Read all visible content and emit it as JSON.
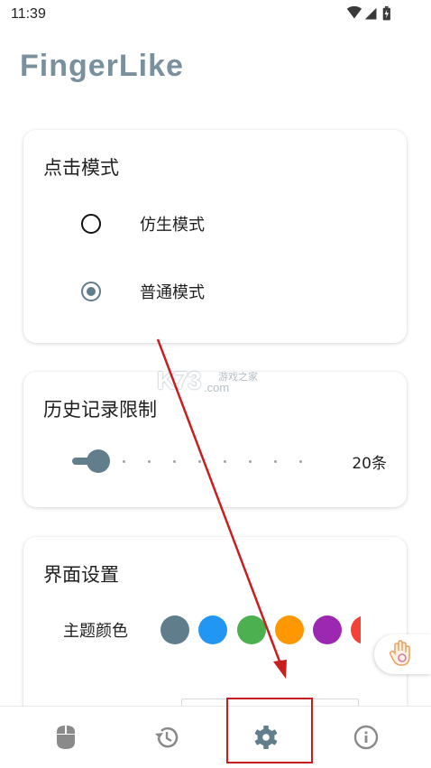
{
  "status": {
    "time": "11:39"
  },
  "app": {
    "title": "FingerLike"
  },
  "click_mode": {
    "title": "点击模式",
    "options": [
      {
        "label": "仿生模式",
        "selected": false
      },
      {
        "label": "普通模式",
        "selected": true
      }
    ]
  },
  "history": {
    "title": "历史记录限制",
    "value_label": "20条",
    "slider_fraction": 0.0
  },
  "ui_settings": {
    "title": "界面设置",
    "theme_label": "主题颜色",
    "colors": [
      "#607d8b",
      "#2196f3",
      "#4caf50",
      "#ff9800",
      "#9c27b0",
      "#f44336"
    ]
  },
  "watermark": {
    "big": "K73",
    "small1": "游戏之家",
    "small2": ".com"
  },
  "nav": {
    "items": [
      {
        "icon": "mouse-icon"
      },
      {
        "icon": "history-icon"
      },
      {
        "icon": "gear-icon"
      },
      {
        "icon": "info-icon"
      }
    ]
  },
  "colors": {
    "accent": "#627d8c",
    "annotation": "#c71f1f"
  }
}
